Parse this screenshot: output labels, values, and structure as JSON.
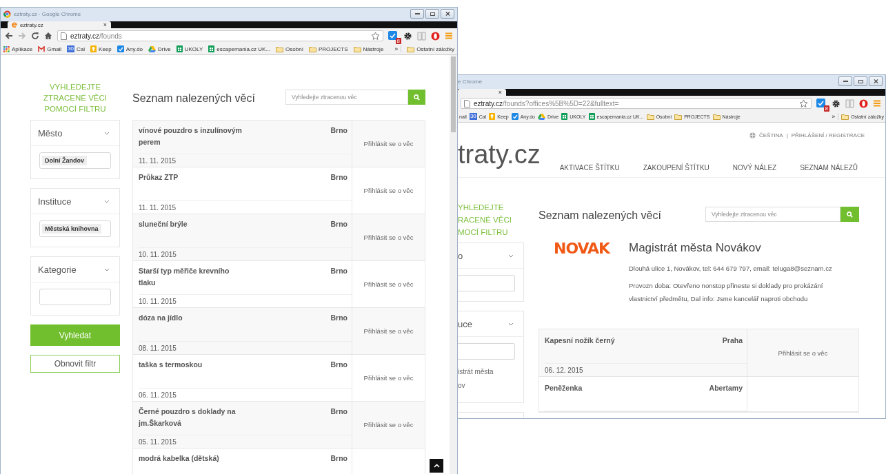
{
  "left_window": {
    "title": "eztraty.cz - Google Chrome",
    "tab": "eztraty.cz",
    "tab_close": "×",
    "url_host": "eztraty.cz",
    "url_path": "/founds",
    "ext_badge": "8",
    "bookmarks": [
      {
        "kind": "apps",
        "label": "Aplikace"
      },
      {
        "kind": "gmail",
        "label": "Gmail"
      },
      {
        "kind": "cal",
        "label": "Cal",
        "icon_text": "30"
      },
      {
        "kind": "keep",
        "label": "Keep"
      },
      {
        "kind": "anydo",
        "label": "Any.do"
      },
      {
        "kind": "drive",
        "label": "Drive"
      },
      {
        "kind": "sheet",
        "label": "UKOLY"
      },
      {
        "kind": "sheet",
        "label": "escapemania.cz UK..."
      },
      {
        "kind": "folder",
        "label": "Osobní"
      },
      {
        "kind": "folder",
        "label": "PROJECTS"
      },
      {
        "kind": "folder",
        "label": "Nástroje"
      }
    ],
    "more": "»",
    "other_bookmarks": "Ostatní záložky",
    "page": {
      "filter_heading": "VYHLEDEJTE ZTRACENÉ VĚCI POMOCÍ FILTRU",
      "filters": [
        {
          "label": "Město",
          "value": "Dolní Žandov"
        },
        {
          "label": "Instituce",
          "value": "Městská knihovna"
        },
        {
          "label": "Kategorie"
        }
      ],
      "search_button": "Vyhledat",
      "reset_button": "Obnovit filtr",
      "list_title": "Seznam nalezených věcí",
      "search_placeholder": "Vyhledejte ztracenou věc",
      "items": [
        {
          "name": "vínové pouzdro s inzulínovým perem",
          "city": "Brno",
          "date": "11. 11. 2015",
          "action": "Přihlásit se o věc"
        },
        {
          "name": "Průkaz ZTP",
          "city": "Brno",
          "date": "11. 11. 2015",
          "action": "Přihlásit se o věc"
        },
        {
          "name": "sluneční brýle",
          "city": "Brno",
          "date": "10. 11. 2015",
          "action": "Přihlásit se o věc"
        },
        {
          "name": "Starší typ měřiče krevního tlaku",
          "city": "Brno",
          "date": "10. 11. 2015",
          "action": "Přihlásit se o věc"
        },
        {
          "name": "dóza na jídlo",
          "city": "Brno",
          "date": "08. 11. 2015",
          "action": "Přihlásit se o věc"
        },
        {
          "name": "taška s termoskou",
          "city": "Brno",
          "date": "06. 11. 2015",
          "action": "Přihlásit se o věc"
        },
        {
          "name": "Černé pouzdro s doklady na jm.Škarková",
          "city": "Brno",
          "date": "05. 11. 2015",
          "action": "Přihlásit se o věc"
        },
        {
          "name": "modrá kabelka (dětská)",
          "city": "Brno"
        }
      ]
    }
  },
  "right_window": {
    "title": "e Chrome",
    "tab_close": "×",
    "url_host": "eztraty.cz",
    "url_path": "/founds?offices%5B%5D=22&fulltext=",
    "ext_badge": "8",
    "bookmarks": [
      {
        "kind": "none",
        "label": "nail"
      },
      {
        "kind": "cal",
        "label": "Cal",
        "icon_text": "30"
      },
      {
        "kind": "keep",
        "label": "Keep"
      },
      {
        "kind": "anydo",
        "label": "Any.do"
      },
      {
        "kind": "drive",
        "label": "Drive"
      },
      {
        "kind": "sheet",
        "label": "UKOLY"
      },
      {
        "kind": "sheet",
        "label": "escapemania.cz UK..."
      },
      {
        "kind": "folder",
        "label": "Osobní"
      },
      {
        "kind": "folder",
        "label": "PROJECTS"
      },
      {
        "kind": "folder",
        "label": "Nástroje"
      }
    ],
    "more": "»",
    "other_bookmarks": "Ostatní záložky",
    "page": {
      "language": "ČEŠTINA",
      "separator": "|",
      "login": "PŘIHLÁŠENÍ / REGISTRACE",
      "logo": "traty.cz",
      "nav": [
        "AKTIVACE ŠTÍTKU",
        "ZAKOUPENÍ ŠTÍTKU",
        "NOVÝ NÁLEZ",
        "SEZNAM NÁLEZŮ"
      ],
      "filter_heading_lines": [
        "YHLEDEJTE",
        "RACENÉ VĚCI",
        "MOCÍ FILTRU"
      ],
      "filters": [
        {
          "label": "o"
        },
        {
          "label": "uce",
          "note_lines": [
            "istrát města",
            "ov"
          ]
        }
      ],
      "list_title": "Seznam nalezených věcí",
      "search_placeholder": "Vyhledejte ztracenou věc",
      "office": {
        "logo": "NOVAK",
        "name": "Magistrát města Novákov",
        "address": "Dlouhá ulice 1, Novákov, tel: 644 679 797, email: teluga8@seznam.cz",
        "hours": "Provozn doba: Otevřeno nonstop přineste si doklady pro prokázání vlastnictví předmětu, Dal info: Jsme kancelář naproti obchodu"
      },
      "items": [
        {
          "name": "Kapesní nožík černý",
          "city": "Praha",
          "date": "06. 12. 2015",
          "action": "Přihlásit se o věc"
        },
        {
          "name": "Peněženka",
          "city": "Abertamy"
        }
      ]
    }
  }
}
